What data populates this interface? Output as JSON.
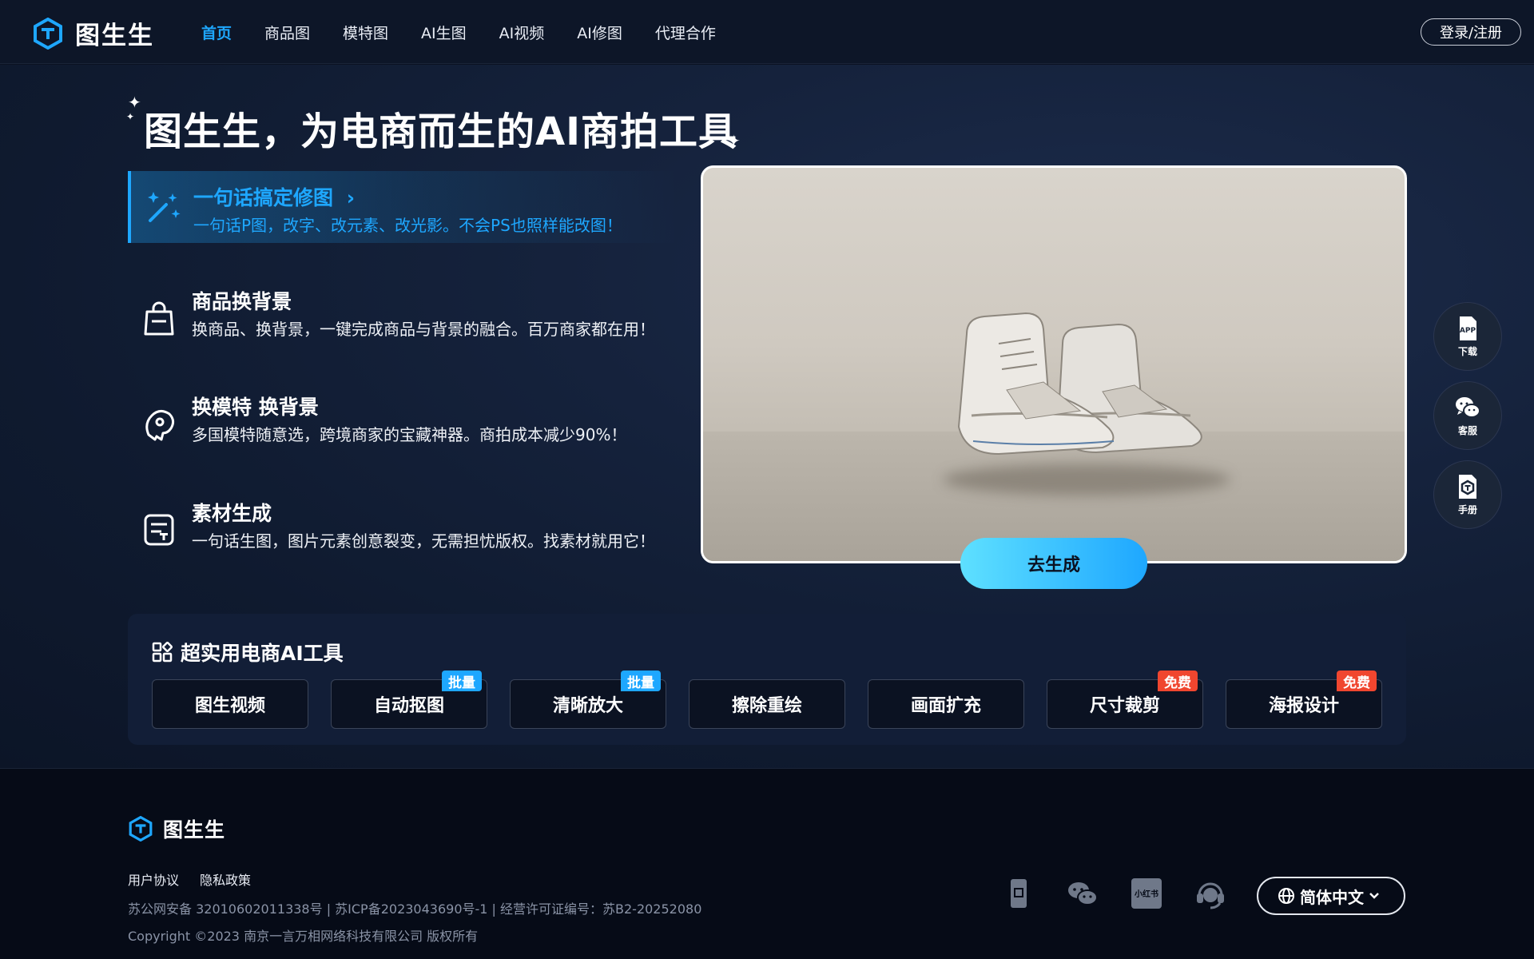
{
  "nav": {
    "logo_text": "图生生",
    "items": [
      {
        "label": "首页",
        "active": true
      },
      {
        "label": "商品图"
      },
      {
        "label": "模特图"
      },
      {
        "label": "AI生图"
      },
      {
        "label": "AI视频"
      },
      {
        "label": "AI修图"
      },
      {
        "label": "代理合作"
      }
    ],
    "login_label": "登录/注册"
  },
  "hero": {
    "title": "图生生，为电商而生的AI商拍工具",
    "features": [
      {
        "icon": "magic-wand-icon",
        "title": "一句话搞定修图",
        "arrow": "›",
        "desc": "一句话P图，改字、改元素、改光影。不会PS也照样能改图！"
      },
      {
        "icon": "shopping-bag-icon",
        "title": "商品换背景",
        "desc": "换商品、换背景，一键完成商品与背景的融合。百万商家都在用！"
      },
      {
        "icon": "model-icon",
        "title": "换模特 换背景",
        "desc": "多国模特随意选，跨境商家的宝藏神器。商拍成本减少90%！"
      },
      {
        "icon": "material-icon",
        "title": "素材生成",
        "desc": "一句话生图，图片元素创意裂变，无需担忧版权。找素材就用它！"
      }
    ],
    "go_button": "去生成"
  },
  "tools": {
    "title": "超实用电商AI工具",
    "items": [
      {
        "label": "图生视频"
      },
      {
        "label": "自动抠图",
        "badge": "批量",
        "badge_color": "#1ea7ff"
      },
      {
        "label": "清晰放大",
        "badge": "批量",
        "badge_color": "#1ea7ff"
      },
      {
        "label": "擦除重绘"
      },
      {
        "label": "画面扩充"
      },
      {
        "label": "尺寸裁剪",
        "badge": "免费",
        "badge_color": "#f0462f"
      },
      {
        "label": "海报设计",
        "badge": "免费",
        "badge_color": "#f0462f"
      }
    ]
  },
  "floating": [
    {
      "icon": "app-download-icon",
      "label": "下载",
      "badge_text": "APP"
    },
    {
      "icon": "wechat-icon",
      "label": "客服"
    },
    {
      "icon": "manual-icon",
      "label": "手册"
    }
  ],
  "footer": {
    "logo_text": "图生生",
    "links": [
      "用户协议",
      "隐私政策"
    ],
    "info": "苏公网安备 32010602011338号 | 苏ICP备2023043690号-1 | 经营许可证编号：苏B2-20252080",
    "copyright": "Copyright ©2023 南京一言万相网络科技有限公司 版权所有",
    "social": [
      {
        "icon": "phone-icon"
      },
      {
        "icon": "wechat-icon"
      },
      {
        "icon": "xiaohongshu-icon",
        "text": "小红书"
      },
      {
        "icon": "customer-service-icon"
      }
    ],
    "language": "简体中文"
  },
  "colors": {
    "accent": "#1ea7ff",
    "badge_red": "#f0462f",
    "background": "#0b1222"
  }
}
